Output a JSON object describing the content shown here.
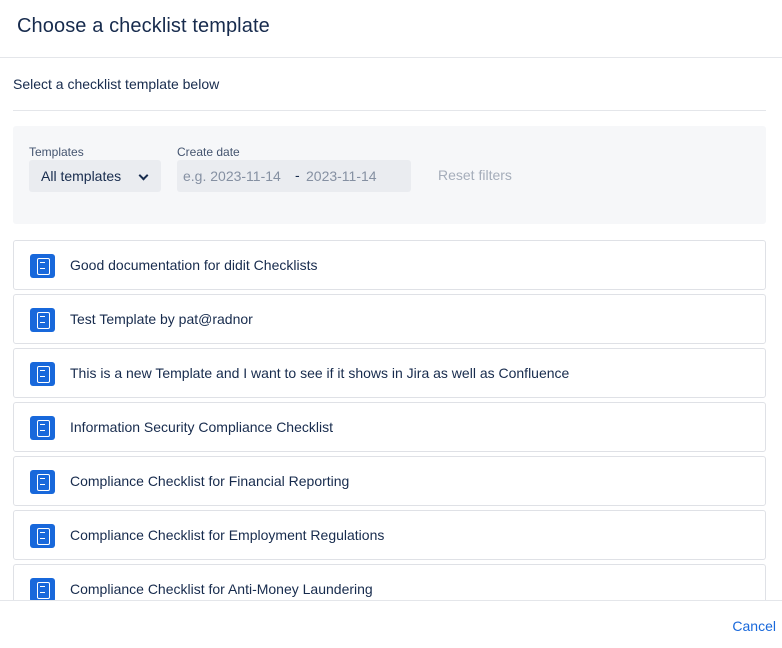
{
  "modal": {
    "title": "Choose a checklist template",
    "subtitle": "Select a checklist template below"
  },
  "filters": {
    "templates_label": "Templates",
    "templates_value": "All templates",
    "date_label": "Create date",
    "date_from_placeholder": "e.g. 2023-11-14",
    "date_separator": "-",
    "date_to_placeholder": "2023-11-14",
    "reset_label": "Reset filters"
  },
  "templates": [
    {
      "name": "Good documentation for didit Checklists",
      "icon": "page-icon"
    },
    {
      "name": "Test Template by pat@radnor",
      "icon": "page-icon"
    },
    {
      "name": "This is a new Template and I want to see if it shows in Jira as well as Confluence",
      "icon": "page-icon"
    },
    {
      "name": "Information Security Compliance Checklist",
      "icon": "page-icon"
    },
    {
      "name": "Compliance Checklist for Financial Reporting",
      "icon": "page-icon"
    },
    {
      "name": "Compliance Checklist for Employment Regulations",
      "icon": "page-icon"
    },
    {
      "name": "Compliance Checklist for Anti-Money Laundering",
      "icon": "page-icon"
    }
  ],
  "footer": {
    "cancel_label": "Cancel"
  },
  "colors": {
    "accent": "#1868db",
    "text": "#172b4d",
    "muted": "#a5adba"
  }
}
